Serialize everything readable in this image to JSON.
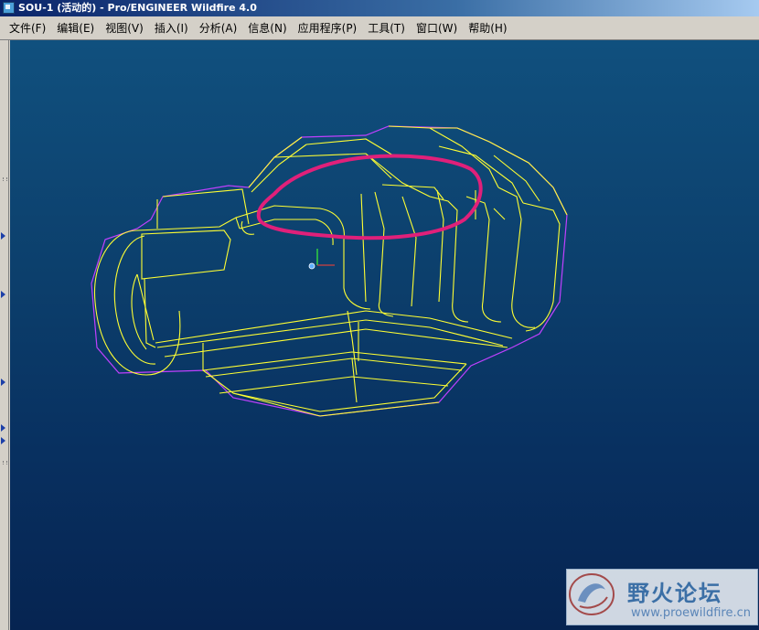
{
  "window": {
    "title": "SOU-1 (活动的) - Pro/ENGINEER Wildfire 4.0"
  },
  "menu": {
    "items": [
      {
        "label": "文件(F)"
      },
      {
        "label": "编辑(E)"
      },
      {
        "label": "视图(V)"
      },
      {
        "label": "插入(I)"
      },
      {
        "label": "分析(A)"
      },
      {
        "label": "信息(N)"
      },
      {
        "label": "应用程序(P)"
      },
      {
        "label": "工具(T)"
      },
      {
        "label": "窗口(W)"
      },
      {
        "label": "帮助(H)"
      }
    ]
  },
  "viewport": {
    "background_top": "#10507e",
    "background_bottom": "#062451",
    "model_edge_color": "#ffff00",
    "silhouette_color": "#c040ff",
    "annotation_color": "#e0207a",
    "icons": [
      "coordinate-triad-icon"
    ]
  },
  "left_dock": {
    "icons": [
      "expand-arrow-icon",
      "expand-arrow-icon",
      "expand-arrow-icon",
      "expand-arrow-icon",
      "expand-arrow-icon"
    ]
  },
  "watermark": {
    "name_cn": "野火论坛",
    "url": "www.proewildfire.cn"
  }
}
